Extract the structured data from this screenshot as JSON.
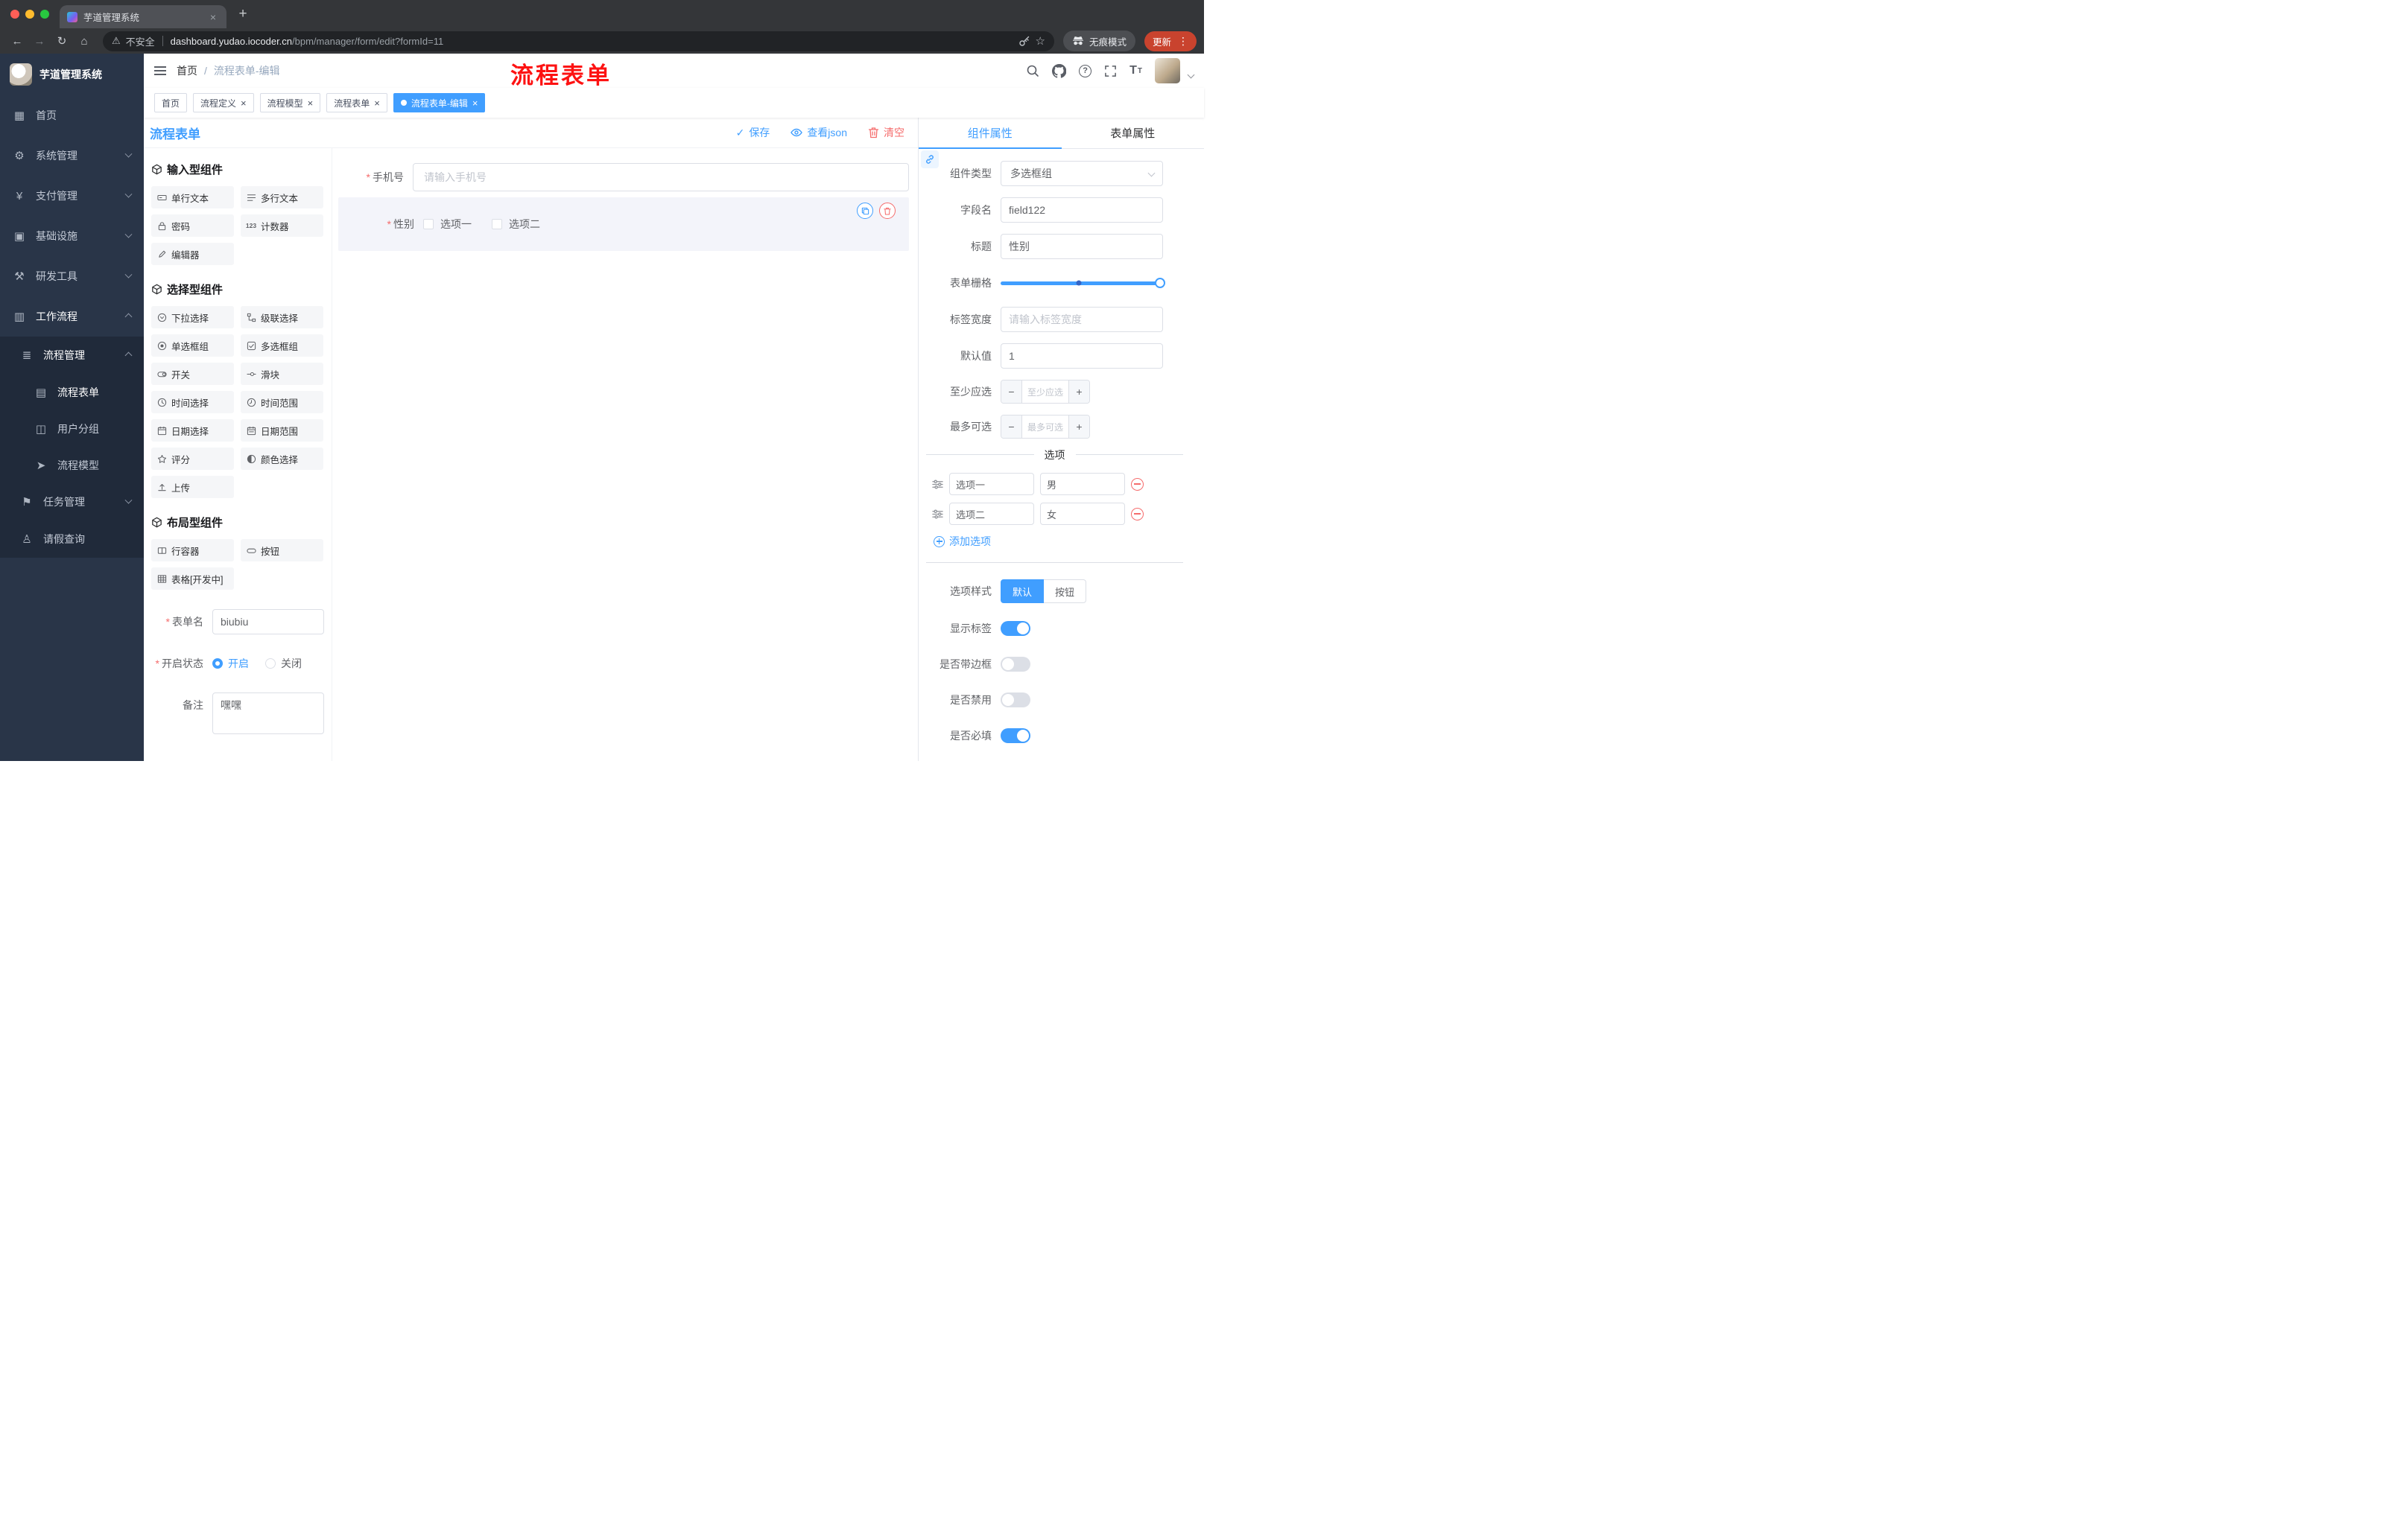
{
  "browser": {
    "tab_title": "芋道管理系统",
    "address": {
      "security_label": "不安全",
      "host": "dashboard.yudao.iocoder.cn",
      "path": "/bpm/manager/form/edit?formId=11"
    },
    "incognito_label": "无痕模式",
    "update_label": "更新"
  },
  "sidebar": {
    "logo_title": "芋道管理系统",
    "items": [
      {
        "label": "首页",
        "icon": "dashboard-icon"
      },
      {
        "label": "系统管理",
        "icon": "gear-icon"
      },
      {
        "label": "支付管理",
        "icon": "yen-icon"
      },
      {
        "label": "基础设施",
        "icon": "infrastructure-icon"
      },
      {
        "label": "研发工具",
        "icon": "tools-icon"
      },
      {
        "label": "工作流程",
        "icon": "workflow-icon"
      }
    ],
    "submenu": {
      "process_mgmt": {
        "label": "流程管理",
        "icon": "list-icon"
      },
      "children": [
        {
          "label": "流程表单",
          "icon": "form-doc-icon",
          "active": true
        },
        {
          "label": "用户分组",
          "icon": "user-group-icon"
        },
        {
          "label": "流程模型",
          "icon": "model-send-icon"
        }
      ],
      "task_mgmt": {
        "label": "任务管理",
        "icon": "flag-icon"
      },
      "leave_query": {
        "label": "请假查询",
        "icon": "person-icon"
      }
    }
  },
  "header": {
    "breadcrumb": {
      "home": "首页",
      "sep": "/",
      "current": "流程表单-编辑"
    },
    "annotation": "流程表单"
  },
  "tags": [
    {
      "label": "首页",
      "closable": false,
      "active": false
    },
    {
      "label": "流程定义",
      "closable": true,
      "active": false
    },
    {
      "label": "流程模型",
      "closable": true,
      "active": false
    },
    {
      "label": "流程表单",
      "closable": true,
      "active": false
    },
    {
      "label": "流程表单-编辑",
      "closable": true,
      "active": true
    }
  ],
  "toolbar": {
    "title": "流程表单",
    "save": "保存",
    "view_json": "查看json",
    "clear": "清空"
  },
  "palette": {
    "groups": [
      {
        "title": "输入型组件",
        "items": [
          {
            "label": "单行文本",
            "icon": "single-line-text-icon"
          },
          {
            "label": "多行文本",
            "icon": "multi-line-text-icon"
          },
          {
            "label": "密码",
            "icon": "lock-icon"
          },
          {
            "label": "计数器",
            "icon": "counter-123-icon"
          },
          {
            "label": "编辑器",
            "icon": "editor-icon"
          }
        ]
      },
      {
        "title": "选择型组件",
        "items": [
          {
            "label": "下拉选择",
            "icon": "dropdown-icon"
          },
          {
            "label": "级联选择",
            "icon": "cascade-icon"
          },
          {
            "label": "单选框组",
            "icon": "radio-group-icon"
          },
          {
            "label": "多选框组",
            "icon": "checkbox-group-icon"
          },
          {
            "label": "开关",
            "icon": "switch-icon"
          },
          {
            "label": "滑块",
            "icon": "slider-icon"
          },
          {
            "label": "时间选择",
            "icon": "time-picker-icon"
          },
          {
            "label": "时间范围",
            "icon": "time-range-icon"
          },
          {
            "label": "日期选择",
            "icon": "date-picker-icon"
          },
          {
            "label": "日期范围",
            "icon": "date-range-icon"
          },
          {
            "label": "评分",
            "icon": "rating-star-icon"
          },
          {
            "label": "颜色选择",
            "icon": "color-picker-icon"
          },
          {
            "label": "上传",
            "icon": "upload-icon"
          }
        ]
      },
      {
        "title": "布局型组件",
        "items": [
          {
            "label": "行容器",
            "icon": "row-container-icon"
          },
          {
            "label": "按钮",
            "icon": "button-icon"
          },
          {
            "label": "表格[开发中]",
            "icon": "table-icon"
          }
        ]
      }
    ],
    "counter_icon_text": "123",
    "form": {
      "form_name_label": "表单名",
      "form_name_value": "biubiu",
      "status_label": "开启状态",
      "status_on": "开启",
      "status_off": "关闭",
      "remark_label": "备注",
      "remark_value": "嘿嘿"
    }
  },
  "canvas": {
    "phone": {
      "label": "手机号",
      "placeholder": "请输入手机号"
    },
    "gender": {
      "label": "性别",
      "option1": "选项一",
      "option2": "选项二"
    }
  },
  "inspector": {
    "tab_component": "组件属性",
    "tab_form": "表单属性",
    "rows": {
      "component_type_label": "组件类型",
      "component_type_value": "多选框组",
      "field_name_label": "字段名",
      "field_name_value": "field122",
      "title_label": "标题",
      "title_value": "性别",
      "grid_label": "表单栅格",
      "label_width_label": "标签宽度",
      "label_width_placeholder": "请输入标签宽度",
      "default_label": "默认值",
      "default_value": "1",
      "min_label": "至少应选",
      "min_placeholder": "至少应选",
      "max_label": "最多可选",
      "max_placeholder": "最多可选"
    },
    "options_title": "选项",
    "options": [
      {
        "label": "选项一",
        "value": "男"
      },
      {
        "label": "选项二",
        "value": "女"
      }
    ],
    "add_option": "添加选项",
    "option_style_label": "选项样式",
    "style_default": "默认",
    "style_button": "按钮",
    "switch_rows": [
      {
        "label": "显示标签",
        "on": true
      },
      {
        "label": "是否带边框",
        "on": false
      },
      {
        "label": "是否禁用",
        "on": false
      },
      {
        "label": "是否必填",
        "on": true
      }
    ]
  },
  "colors": {
    "accent": "#409eff",
    "danger": "#f56c6c",
    "annotation": "#fd1212",
    "sidebar_bg": "#293548",
    "active_tag_bg": "#409eff"
  }
}
